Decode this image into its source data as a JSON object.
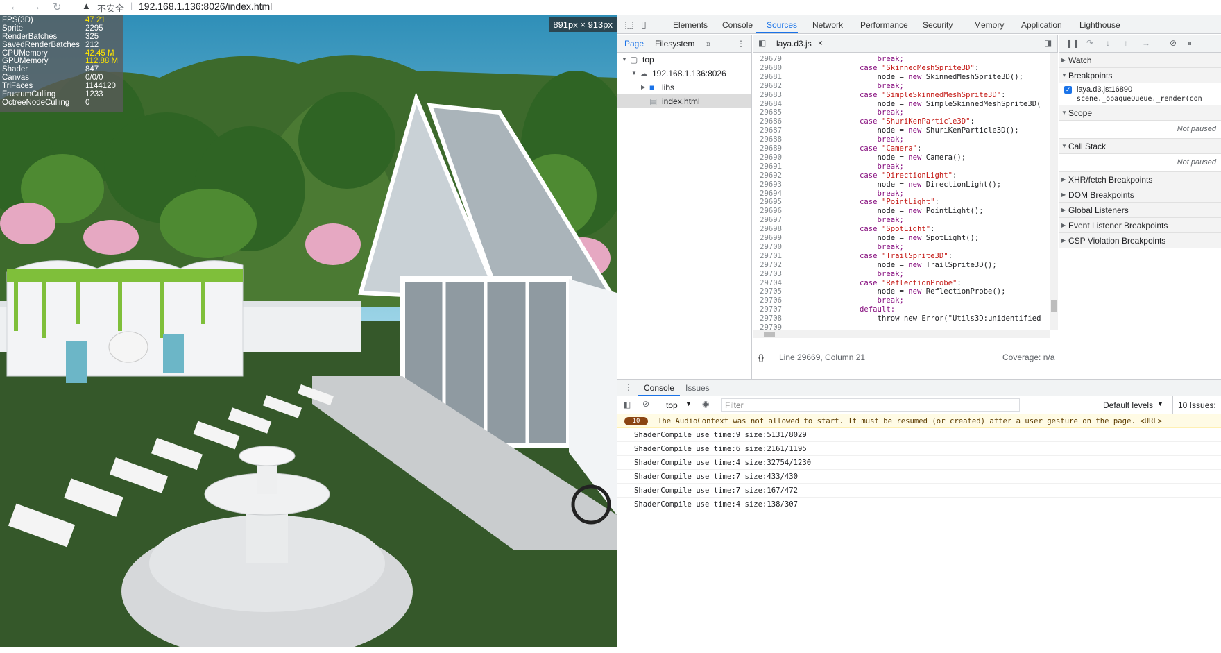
{
  "browser": {
    "back_glyph": "←",
    "forward_glyph": "→",
    "reload_glyph": "↻",
    "security_text": "不安全",
    "url": "192.168.1.136:8026/index.html"
  },
  "game": {
    "dimension_label": "891px × 913px",
    "stats": [
      {
        "key": "FPS(3D)",
        "value": "47 21",
        "highlight": true
      },
      {
        "key": "Sprite",
        "value": "2295",
        "highlight": false
      },
      {
        "key": "RenderBatches",
        "value": "325",
        "highlight": false
      },
      {
        "key": "SavedRenderBatches",
        "value": "212",
        "highlight": false
      },
      {
        "key": "CPUMemory",
        "value": "42.45 M",
        "highlight": true
      },
      {
        "key": "GPUMemory",
        "value": "112.88 M",
        "highlight": true
      },
      {
        "key": "Shader",
        "value": "847",
        "highlight": false
      },
      {
        "key": "Canvas",
        "value": "0/0/0",
        "highlight": false
      },
      {
        "key": "TriFaces",
        "value": "1144120",
        "highlight": false
      },
      {
        "key": "FrustumCulling",
        "value": "1233",
        "highlight": false
      },
      {
        "key": "OctreeNodeCulling",
        "value": "0",
        "highlight": false
      }
    ]
  },
  "devtools": {
    "tabs": [
      "Elements",
      "Console",
      "Sources",
      "Network",
      "Performance",
      "Security",
      "Memory",
      "Application",
      "Lighthouse"
    ],
    "active_tab": "Sources",
    "navigator": {
      "tabs": [
        "Page",
        "Filesystem"
      ],
      "more": "»",
      "menu": "⋮",
      "tree": [
        {
          "label": "top",
          "indent": 0,
          "arrow": "▼",
          "icon": "frame"
        },
        {
          "label": "192.168.1.136:8026",
          "indent": 1,
          "arrow": "▼",
          "icon": "cloud"
        },
        {
          "label": "libs",
          "indent": 2,
          "arrow": "▶",
          "icon": "folder"
        },
        {
          "label": "index.html",
          "indent": 2,
          "arrow": "",
          "icon": "file"
        }
      ]
    },
    "editor": {
      "file_tab": "laya.d3.js",
      "close": "×",
      "status_left": "{}",
      "status_pos": "Line 29669, Column 21",
      "coverage": "Coverage: n/a",
      "lines": [
        {
          "n": "29679",
          "parts": [
            {
              "t": "                    break;",
              "c": "kw"
            }
          ]
        },
        {
          "n": "29680",
          "parts": [
            {
              "t": "                case ",
              "c": "kw"
            },
            {
              "t": "\"SkinnedMeshSprite3D\"",
              "c": "str"
            },
            {
              "t": ":",
              "c": "ty"
            }
          ]
        },
        {
          "n": "29681",
          "parts": [
            {
              "t": "                    node = ",
              "c": "ty"
            },
            {
              "t": "new",
              "c": "kw"
            },
            {
              "t": " SkinnedMeshSprite3D();",
              "c": "ty"
            }
          ]
        },
        {
          "n": "29682",
          "parts": [
            {
              "t": "                    break;",
              "c": "kw"
            }
          ]
        },
        {
          "n": "29683",
          "parts": [
            {
              "t": "                case ",
              "c": "kw"
            },
            {
              "t": "\"SimpleSkinnedMeshSprite3D\"",
              "c": "str"
            },
            {
              "t": ":",
              "c": "ty"
            }
          ]
        },
        {
          "n": "29684",
          "parts": [
            {
              "t": "                    node = ",
              "c": "ty"
            },
            {
              "t": "new",
              "c": "kw"
            },
            {
              "t": " SimpleSkinnedMeshSprite3D(",
              "c": "ty"
            }
          ]
        },
        {
          "n": "29685",
          "parts": [
            {
              "t": "                    break;",
              "c": "kw"
            }
          ]
        },
        {
          "n": "29686",
          "parts": [
            {
              "t": "                case ",
              "c": "kw"
            },
            {
              "t": "\"ShuriKenParticle3D\"",
              "c": "str"
            },
            {
              "t": ":",
              "c": "ty"
            }
          ]
        },
        {
          "n": "29687",
          "parts": [
            {
              "t": "                    node = ",
              "c": "ty"
            },
            {
              "t": "new",
              "c": "kw"
            },
            {
              "t": " ShuriKenParticle3D();",
              "c": "ty"
            }
          ]
        },
        {
          "n": "29688",
          "parts": [
            {
              "t": "                    break;",
              "c": "kw"
            }
          ]
        },
        {
          "n": "29689",
          "parts": [
            {
              "t": "                case ",
              "c": "kw"
            },
            {
              "t": "\"Camera\"",
              "c": "str"
            },
            {
              "t": ":",
              "c": "ty"
            }
          ]
        },
        {
          "n": "29690",
          "parts": [
            {
              "t": "                    node = ",
              "c": "ty"
            },
            {
              "t": "new",
              "c": "kw"
            },
            {
              "t": " Camera();",
              "c": "ty"
            }
          ]
        },
        {
          "n": "29691",
          "parts": [
            {
              "t": "                    break;",
              "c": "kw"
            }
          ]
        },
        {
          "n": "29692",
          "parts": [
            {
              "t": "                case ",
              "c": "kw"
            },
            {
              "t": "\"DirectionLight\"",
              "c": "str"
            },
            {
              "t": ":",
              "c": "ty"
            }
          ]
        },
        {
          "n": "29693",
          "parts": [
            {
              "t": "                    node = ",
              "c": "ty"
            },
            {
              "t": "new",
              "c": "kw"
            },
            {
              "t": " DirectionLight();",
              "c": "ty"
            }
          ]
        },
        {
          "n": "29694",
          "parts": [
            {
              "t": "                    break;",
              "c": "kw"
            }
          ]
        },
        {
          "n": "29695",
          "parts": [
            {
              "t": "                case ",
              "c": "kw"
            },
            {
              "t": "\"PointLight\"",
              "c": "str"
            },
            {
              "t": ":",
              "c": "ty"
            }
          ]
        },
        {
          "n": "29696",
          "parts": [
            {
              "t": "                    node = ",
              "c": "ty"
            },
            {
              "t": "new",
              "c": "kw"
            },
            {
              "t": " PointLight();",
              "c": "ty"
            }
          ]
        },
        {
          "n": "29697",
          "parts": [
            {
              "t": "                    break;",
              "c": "kw"
            }
          ]
        },
        {
          "n": "29698",
          "parts": [
            {
              "t": "                case ",
              "c": "kw"
            },
            {
              "t": "\"SpotLight\"",
              "c": "str"
            },
            {
              "t": ":",
              "c": "ty"
            }
          ]
        },
        {
          "n": "29699",
          "parts": [
            {
              "t": "                    node = ",
              "c": "ty"
            },
            {
              "t": "new",
              "c": "kw"
            },
            {
              "t": " SpotLight();",
              "c": "ty"
            }
          ]
        },
        {
          "n": "29700",
          "parts": [
            {
              "t": "                    break;",
              "c": "kw"
            }
          ]
        },
        {
          "n": "29701",
          "parts": [
            {
              "t": "                case ",
              "c": "kw"
            },
            {
              "t": "\"TrailSprite3D\"",
              "c": "str"
            },
            {
              "t": ":",
              "c": "ty"
            }
          ]
        },
        {
          "n": "29702",
          "parts": [
            {
              "t": "                    node = ",
              "c": "ty"
            },
            {
              "t": "new",
              "c": "kw"
            },
            {
              "t": " TrailSprite3D();",
              "c": "ty"
            }
          ]
        },
        {
          "n": "29703",
          "parts": [
            {
              "t": "                    break;",
              "c": "kw"
            }
          ]
        },
        {
          "n": "29704",
          "parts": [
            {
              "t": "                case ",
              "c": "kw"
            },
            {
              "t": "\"ReflectionProbe\"",
              "c": "str"
            },
            {
              "t": ":",
              "c": "ty"
            }
          ]
        },
        {
          "n": "29705",
          "parts": [
            {
              "t": "                    node = ",
              "c": "ty"
            },
            {
              "t": "new",
              "c": "kw"
            },
            {
              "t": " ReflectionProbe();",
              "c": "ty"
            }
          ]
        },
        {
          "n": "29706",
          "parts": [
            {
              "t": "                    break;",
              "c": "kw"
            }
          ]
        },
        {
          "n": "29707",
          "parts": [
            {
              "t": "                default:",
              "c": "kw"
            }
          ]
        },
        {
          "n": "29708",
          "parts": [
            {
              "t": "                    throw new Error(\"Utils3D:unidentified",
              "c": "ty"
            }
          ]
        },
        {
          "n": "29709",
          "parts": [
            {
              "t": "",
              "c": "ty"
            }
          ]
        }
      ]
    },
    "debugger": {
      "sections": [
        {
          "label": "Watch",
          "open": false
        },
        {
          "label": "Breakpoints",
          "open": true
        },
        {
          "label": "Scope",
          "open": true
        },
        {
          "label": "Call Stack",
          "open": true
        },
        {
          "label": "XHR/fetch Breakpoints",
          "open": false
        },
        {
          "label": "DOM Breakpoints",
          "open": false
        },
        {
          "label": "Global Listeners",
          "open": false
        },
        {
          "label": "Event Listener Breakpoints",
          "open": false
        },
        {
          "label": "CSP Violation Breakpoints",
          "open": false
        }
      ],
      "breakpoint_file": "laya.d3.js:16890",
      "breakpoint_code": "scene._opaqueQueue._render(con",
      "not_paused": "Not paused"
    },
    "console": {
      "tabs": [
        "Console",
        "Issues"
      ],
      "context": "top",
      "filter_placeholder": "Filter",
      "levels": "Default levels",
      "issues": "10 Issues:",
      "warning_count": "10",
      "warning": "The AudioContext was not allowed to start. It must be resumed (or created) after a user gesture on the page. <URL>",
      "logs": [
        "ShaderCompile use time:9  size:5131/8029",
        "ShaderCompile use time:6  size:2161/1195",
        "ShaderCompile use time:4  size:32754/1230",
        "ShaderCompile use time:7  size:433/430",
        "ShaderCompile use time:7  size:167/472",
        "ShaderCompile use time:4  size:138/307"
      ]
    }
  }
}
